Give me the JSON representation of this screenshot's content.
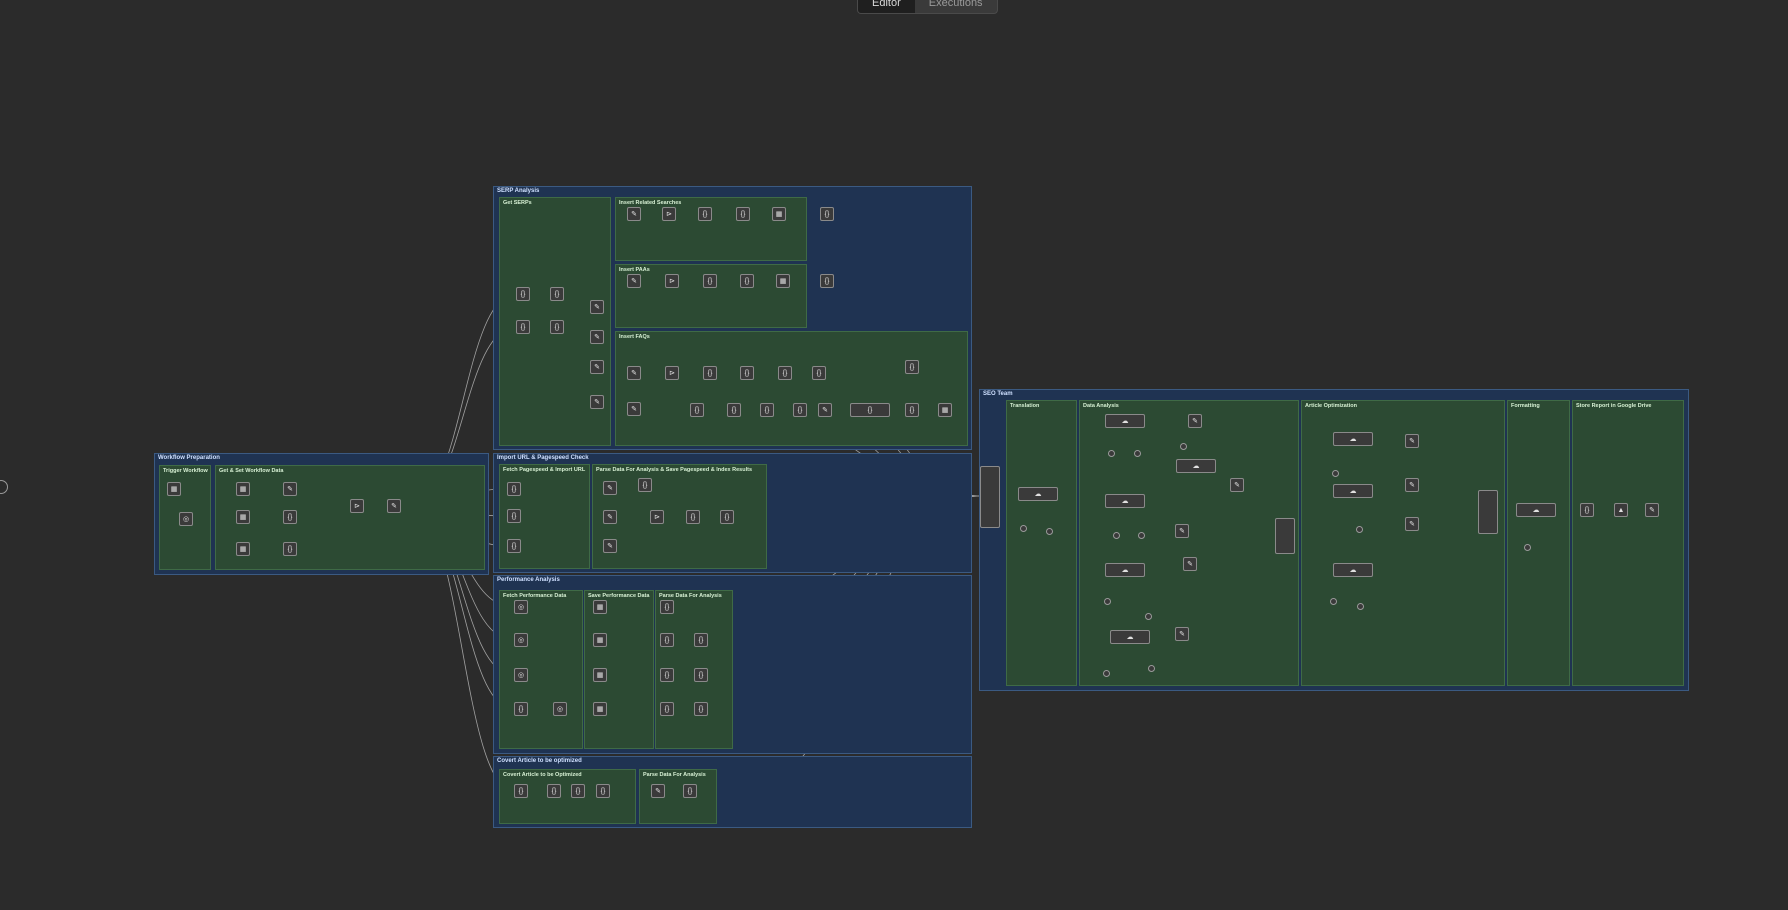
{
  "header": {
    "tabs": [
      "Editor",
      "Executions"
    ],
    "active_tab": "Editor"
  },
  "canvas": {
    "groups": {
      "workflow_preparation": {
        "title": "Workflow Preparation",
        "subs": {
          "trigger": "Trigger Workflow",
          "get_set": "Get & Set Workflow Data"
        }
      },
      "serp_analysis": {
        "title": "SERP Analysis",
        "subs": {
          "get_serps": "Get SERPs",
          "related": "Insert Related Searches",
          "paa": "Insert PAAs",
          "faqs": "Insert FAQs"
        }
      },
      "import_url": {
        "title": "Import URL & Pagespeed Check",
        "subs": {
          "fetch": "Fetch Pagespeed & Import URL",
          "parse": "Parse Data For Analysis & Save Pagespeed & Index Results"
        }
      },
      "performance": {
        "title": "Performance Analysis",
        "subs": {
          "fetch": "Fetch Performance Data",
          "save": "Save Performance Data",
          "parse": "Parse Data For Analysis"
        }
      },
      "convert": {
        "title": "Covert Article to be optimized",
        "subs": {
          "convert": "Covert Article to be Optimized",
          "parse": "Parse Data For Analysis"
        }
      },
      "seo_team": {
        "title": "SEO Team",
        "subs": {
          "translation": "Translation",
          "data_analysis": "Data Analysis",
          "article_opt": "Article Optimization",
          "formatting": "Formatting",
          "store": "Store Report in Google Drive"
        }
      }
    },
    "icons": {
      "edit": "pencil-icon",
      "code": "code-icon",
      "http": "globe-icon",
      "sheet": "sheet-icon",
      "merge": "merge-icon",
      "agent": "robot-icon",
      "drive": "drive-icon"
    },
    "colors": {
      "background": "#2b2b2b",
      "group_blue": "#1f3352",
      "group_green": "#2c4a33",
      "wire": "#c8c8c8"
    }
  }
}
